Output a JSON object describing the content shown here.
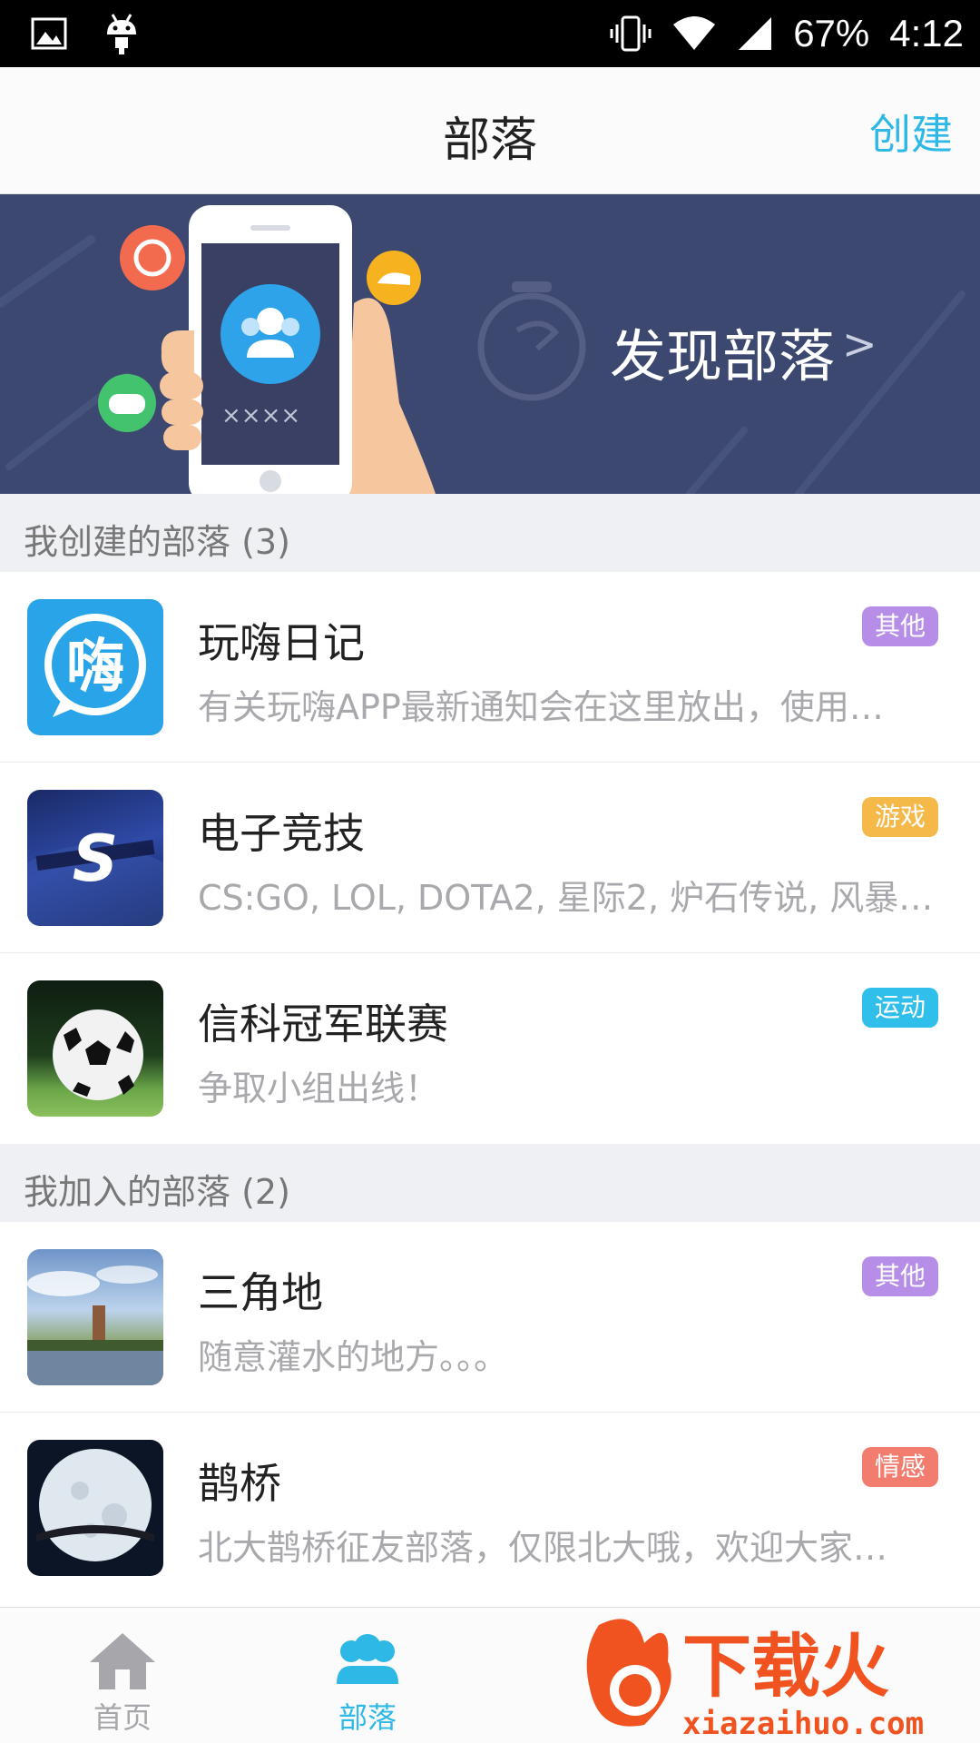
{
  "status_bar": {
    "battery": "67%",
    "time": "4:12",
    "icons": [
      "image-icon",
      "android-icon",
      "vibrate-icon",
      "wifi-icon",
      "signal-icon"
    ]
  },
  "header": {
    "title": "部落",
    "create_label": "创建"
  },
  "banner": {
    "text": "发现部落",
    "arrow": ">",
    "phone_placeholder": "××××"
  },
  "sections": [
    {
      "title": "我创建的部落 (3)",
      "items": [
        {
          "name": "玩嗨日记",
          "desc": "有关玩嗨APP最新通知会在这里放出，使用…",
          "tag": "其他",
          "tag_color": "#b68ee8",
          "thumb": "wanhai-logo",
          "thumb_text": "嗨"
        },
        {
          "name": "电子竞技",
          "desc": "CS:GO, LOL, DOTA2, 星际2, 炉石传说, 风暴…",
          "tag": "游戏",
          "tag_color": "#f5b94a",
          "thumb": "esports-logo",
          "thumb_text": "S"
        },
        {
          "name": "信科冠军联赛",
          "desc": "争取小组出线！",
          "tag": "运动",
          "tag_color": "#2fbfea",
          "thumb": "soccer-ball-photo"
        }
      ]
    },
    {
      "title": "我加入的部落 (2)",
      "items": [
        {
          "name": "三角地",
          "desc": "随意灌水的地方。。。",
          "tag": "其他",
          "tag_color": "#b68ee8",
          "thumb": "lake-tower-photo"
        },
        {
          "name": "鹊桥",
          "desc": "北大鹊桥征友部落，仅限北大哦，欢迎大家…",
          "tag": "情感",
          "tag_color": "#f27d6e",
          "thumb": "moon-photo"
        }
      ]
    }
  ],
  "tabs": [
    {
      "label": "首页",
      "icon": "home-icon",
      "active": false
    },
    {
      "label": "部落",
      "icon": "tribe-icon",
      "active": true
    }
  ],
  "watermark": {
    "title": "下载火",
    "url": "xiazaihuo.com"
  },
  "colors": {
    "accent": "#2eb8e6",
    "banner_bg": "#3c4870",
    "inactive_tab": "#a7a7ab"
  }
}
